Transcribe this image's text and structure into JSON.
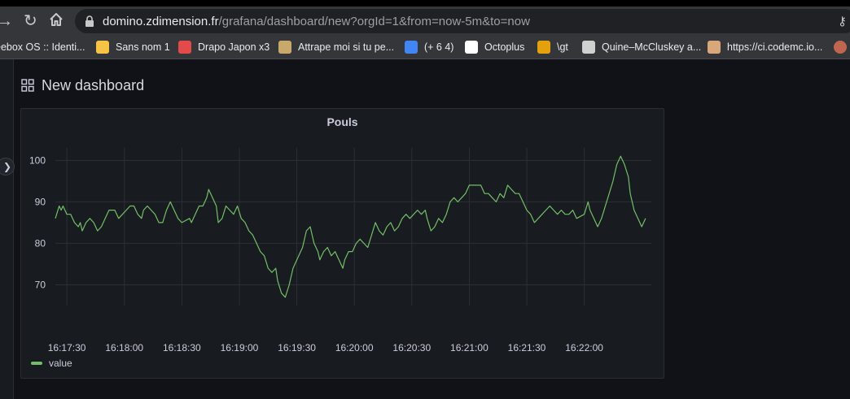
{
  "browser": {
    "url_host": "domino.zdimension.fr",
    "url_rest": "/grafana/dashboard/new?orgId=1&from=now-5m&to=now",
    "bookmarks": [
      {
        "label": "eebox OS :: Identi...",
        "icon": "freebox-icon",
        "color": ""
      },
      {
        "label": "Sans nom 1",
        "icon": "folder-icon",
        "color": "#f6c344"
      },
      {
        "label": "Drapo Japon x3",
        "icon": "flag-icon",
        "color": "#e34a4a"
      },
      {
        "label": "Attrape moi si tu pe...",
        "icon": "bookmark-image-icon",
        "color": "#c9a96b"
      },
      {
        "label": "(+ 6 4)",
        "icon": "calendar-icon",
        "color": "#4285f4"
      },
      {
        "label": "Octoplus",
        "icon": "github-icon",
        "color": "#ffffff"
      },
      {
        "label": "\\gt",
        "icon": "plex-icon",
        "color": "#e5a00d"
      },
      {
        "label": "Quine–McCluskey a...",
        "icon": "wikipedia-icon",
        "color": "#d0d0d0"
      },
      {
        "label": "https://ci.codemc.io...",
        "icon": "jenkins-icon",
        "color": "#d9a87a"
      }
    ]
  },
  "dashboard": {
    "title": "New dashboard"
  },
  "panel": {
    "title": "Pouls"
  },
  "colors": {
    "series": "#73bf69",
    "grid": "#2c3035",
    "axis_text": "#ccccdc"
  },
  "chart_data": {
    "type": "line",
    "title": "Pouls",
    "xlabel": "",
    "ylabel": "",
    "x_tick_labels": [
      "16:17:30",
      "16:18:00",
      "16:18:30",
      "16:19:00",
      "16:19:30",
      "16:20:00",
      "16:20:30",
      "16:21:00",
      "16:21:30",
      "16:22:00"
    ],
    "y_ticks": [
      70,
      80,
      90,
      100
    ],
    "x_range": [
      "16:17:24",
      "16:22:35"
    ],
    "ylim": [
      65,
      103
    ],
    "grid": true,
    "legend_position": "bottom-left",
    "series": [
      {
        "name": "value",
        "color": "#73bf69",
        "points": [
          [
            "16:17:24",
            86
          ],
          [
            "16:17:26",
            89
          ],
          [
            "16:17:27",
            88
          ],
          [
            "16:17:28",
            89
          ],
          [
            "16:17:30",
            87
          ],
          [
            "16:17:32",
            87
          ],
          [
            "16:17:34",
            85
          ],
          [
            "16:17:36",
            84
          ],
          [
            "16:17:37",
            85
          ],
          [
            "16:17:38",
            83
          ],
          [
            "16:17:40",
            85
          ],
          [
            "16:17:42",
            86
          ],
          [
            "16:17:44",
            85
          ],
          [
            "16:17:46",
            83
          ],
          [
            "16:17:48",
            84
          ],
          [
            "16:17:50",
            86
          ],
          [
            "16:17:52",
            88
          ],
          [
            "16:17:55",
            88
          ],
          [
            "16:17:57",
            86
          ],
          [
            "16:17:59",
            87
          ],
          [
            "16:18:01",
            88
          ],
          [
            "16:18:03",
            89
          ],
          [
            "16:18:05",
            89
          ],
          [
            "16:18:07",
            87
          ],
          [
            "16:18:09",
            86
          ],
          [
            "16:18:10",
            88
          ],
          [
            "16:18:12",
            89
          ],
          [
            "16:18:14",
            88
          ],
          [
            "16:18:16",
            87
          ],
          [
            "16:18:18",
            85
          ],
          [
            "16:18:20",
            85
          ],
          [
            "16:18:22",
            88
          ],
          [
            "16:18:24",
            90
          ],
          [
            "16:18:26",
            88
          ],
          [
            "16:18:28",
            86
          ],
          [
            "16:18:30",
            85
          ],
          [
            "16:18:34",
            86
          ],
          [
            "16:18:35",
            85
          ],
          [
            "16:18:37",
            87
          ],
          [
            "16:18:39",
            89
          ],
          [
            "16:18:41",
            89
          ],
          [
            "16:18:43",
            91
          ],
          [
            "16:18:44",
            93
          ],
          [
            "16:18:46",
            91
          ],
          [
            "16:18:48",
            89
          ],
          [
            "16:18:49",
            85
          ],
          [
            "16:18:51",
            86
          ],
          [
            "16:18:53",
            89
          ],
          [
            "16:18:55",
            88
          ],
          [
            "16:18:57",
            87
          ],
          [
            "16:18:59",
            89
          ],
          [
            "16:19:01",
            86
          ],
          [
            "16:19:03",
            85
          ],
          [
            "16:19:05",
            83
          ],
          [
            "16:19:07",
            82
          ],
          [
            "16:19:09",
            80
          ],
          [
            "16:19:11",
            78
          ],
          [
            "16:19:13",
            77
          ],
          [
            "16:19:15",
            74
          ],
          [
            "16:19:17",
            73
          ],
          [
            "16:19:19",
            74
          ],
          [
            "16:19:20",
            71
          ],
          [
            "16:19:22",
            68
          ],
          [
            "16:19:24",
            67
          ],
          [
            "16:19:26",
            70
          ],
          [
            "16:19:28",
            74
          ],
          [
            "16:19:30",
            76
          ],
          [
            "16:19:31",
            77
          ],
          [
            "16:19:33",
            79
          ],
          [
            "16:19:35",
            83
          ],
          [
            "16:19:37",
            84
          ],
          [
            "16:19:39",
            80
          ],
          [
            "16:19:41",
            78
          ],
          [
            "16:19:42",
            76
          ],
          [
            "16:19:44",
            78
          ],
          [
            "16:19:46",
            79
          ],
          [
            "16:19:48",
            77
          ],
          [
            "16:19:50",
            78
          ],
          [
            "16:19:52",
            76
          ],
          [
            "16:19:54",
            74
          ],
          [
            "16:19:55",
            76
          ],
          [
            "16:19:57",
            78
          ],
          [
            "16:19:59",
            78
          ],
          [
            "16:20:01",
            80
          ],
          [
            "16:20:03",
            81
          ],
          [
            "16:20:05",
            80
          ],
          [
            "16:20:07",
            79
          ],
          [
            "16:20:09",
            82
          ],
          [
            "16:20:11",
            85
          ],
          [
            "16:20:13",
            83
          ],
          [
            "16:20:15",
            82
          ],
          [
            "16:20:17",
            84
          ],
          [
            "16:20:19",
            85
          ],
          [
            "16:20:21",
            83
          ],
          [
            "16:20:23",
            84
          ],
          [
            "16:20:25",
            86
          ],
          [
            "16:20:27",
            87
          ],
          [
            "16:20:29",
            86
          ],
          [
            "16:20:31",
            87
          ],
          [
            "16:20:33",
            88
          ],
          [
            "16:20:35",
            87
          ],
          [
            "16:20:37",
            88
          ],
          [
            "16:20:38",
            86
          ],
          [
            "16:20:40",
            83
          ],
          [
            "16:20:42",
            84
          ],
          [
            "16:20:44",
            86
          ],
          [
            "16:20:46",
            85
          ],
          [
            "16:20:48",
            87
          ],
          [
            "16:20:50",
            90
          ],
          [
            "16:20:52",
            91
          ],
          [
            "16:20:54",
            90
          ],
          [
            "16:20:56",
            91
          ],
          [
            "16:20:58",
            92
          ],
          [
            "16:21:00",
            94
          ],
          [
            "16:21:04",
            94
          ],
          [
            "16:21:06",
            94
          ],
          [
            "16:21:08",
            92
          ],
          [
            "16:21:10",
            92
          ],
          [
            "16:21:12",
            91
          ],
          [
            "16:21:14",
            90
          ],
          [
            "16:21:16",
            92
          ],
          [
            "16:21:18",
            91
          ],
          [
            "16:21:20",
            94
          ],
          [
            "16:21:22",
            93
          ],
          [
            "16:21:24",
            92
          ],
          [
            "16:21:26",
            92
          ],
          [
            "16:21:28",
            90
          ],
          [
            "16:21:30",
            88
          ],
          [
            "16:21:32",
            87
          ],
          [
            "16:21:34",
            85
          ],
          [
            "16:21:36",
            86
          ],
          [
            "16:21:38",
            87
          ],
          [
            "16:21:40",
            88
          ],
          [
            "16:21:42",
            89
          ],
          [
            "16:21:44",
            88
          ],
          [
            "16:21:46",
            87
          ],
          [
            "16:21:48",
            88
          ],
          [
            "16:21:50",
            87
          ],
          [
            "16:21:52",
            87
          ],
          [
            "16:21:54",
            88
          ],
          [
            "16:21:56",
            86
          ],
          [
            "16:22:00",
            87
          ],
          [
            "16:22:02",
            90
          ],
          [
            "16:22:03",
            88
          ],
          [
            "16:22:05",
            86
          ],
          [
            "16:22:07",
            84
          ],
          [
            "16:22:09",
            86
          ],
          [
            "16:22:11",
            89
          ],
          [
            "16:22:13",
            92
          ],
          [
            "16:22:15",
            95
          ],
          [
            "16:22:17",
            99
          ],
          [
            "16:22:19",
            101
          ],
          [
            "16:22:21",
            99
          ],
          [
            "16:22:23",
            96
          ],
          [
            "16:22:24",
            92
          ],
          [
            "16:22:26",
            88
          ],
          [
            "16:22:28",
            86
          ],
          [
            "16:22:30",
            84
          ],
          [
            "16:22:32",
            86
          ]
        ]
      }
    ]
  }
}
